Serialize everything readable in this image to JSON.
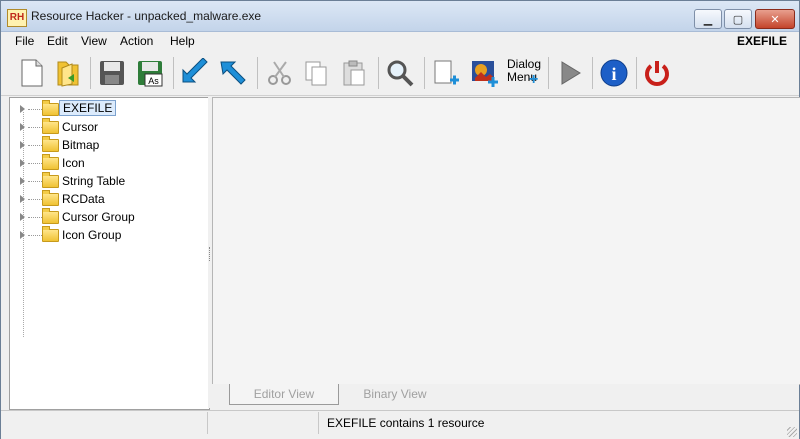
{
  "window": {
    "title": "Resource Hacker - unpacked_malware.exe",
    "app_icon_text": "RH"
  },
  "menubar": {
    "items": [
      "File",
      "Edit",
      "View",
      "Action",
      "Help"
    ],
    "right_label": "EXEFILE"
  },
  "toolbar": {
    "buttons": [
      {
        "icon": "new-file-icon"
      },
      {
        "icon": "open-folder-icon"
      },
      {
        "icon": "save-icon"
      },
      {
        "icon": "save-as-icon",
        "label": "As"
      },
      {
        "icon": "arrow-back-icon"
      },
      {
        "icon": "arrow-forward-icon"
      },
      {
        "icon": "cut-icon"
      },
      {
        "icon": "copy-icon"
      },
      {
        "icon": "paste-icon"
      },
      {
        "icon": "search-icon"
      },
      {
        "icon": "add-blank-resource-icon"
      },
      {
        "icon": "add-image-resource-icon"
      },
      {
        "icon": "dialog-menu-icon",
        "label_line1": "Dialog",
        "label_line2": "Menu"
      },
      {
        "icon": "run-script-icon"
      },
      {
        "icon": "info-icon",
        "label": "i"
      },
      {
        "icon": "power-icon"
      }
    ]
  },
  "tree": {
    "items": [
      {
        "label": "EXEFILE",
        "selected": true
      },
      {
        "label": "Cursor"
      },
      {
        "label": "Bitmap"
      },
      {
        "label": "Icon"
      },
      {
        "label": "String Table"
      },
      {
        "label": "RCData"
      },
      {
        "label": "Cursor Group"
      },
      {
        "label": "Icon Group"
      }
    ]
  },
  "tabs": {
    "editor": "Editor View",
    "binary": "Binary View"
  },
  "status": {
    "text": "EXEFILE contains 1 resource"
  },
  "colors": {
    "arrow_blue": "#1e8fd8",
    "power_red": "#c8201a",
    "info_blue": "#1d5fc7",
    "folder": "#f0c233"
  }
}
